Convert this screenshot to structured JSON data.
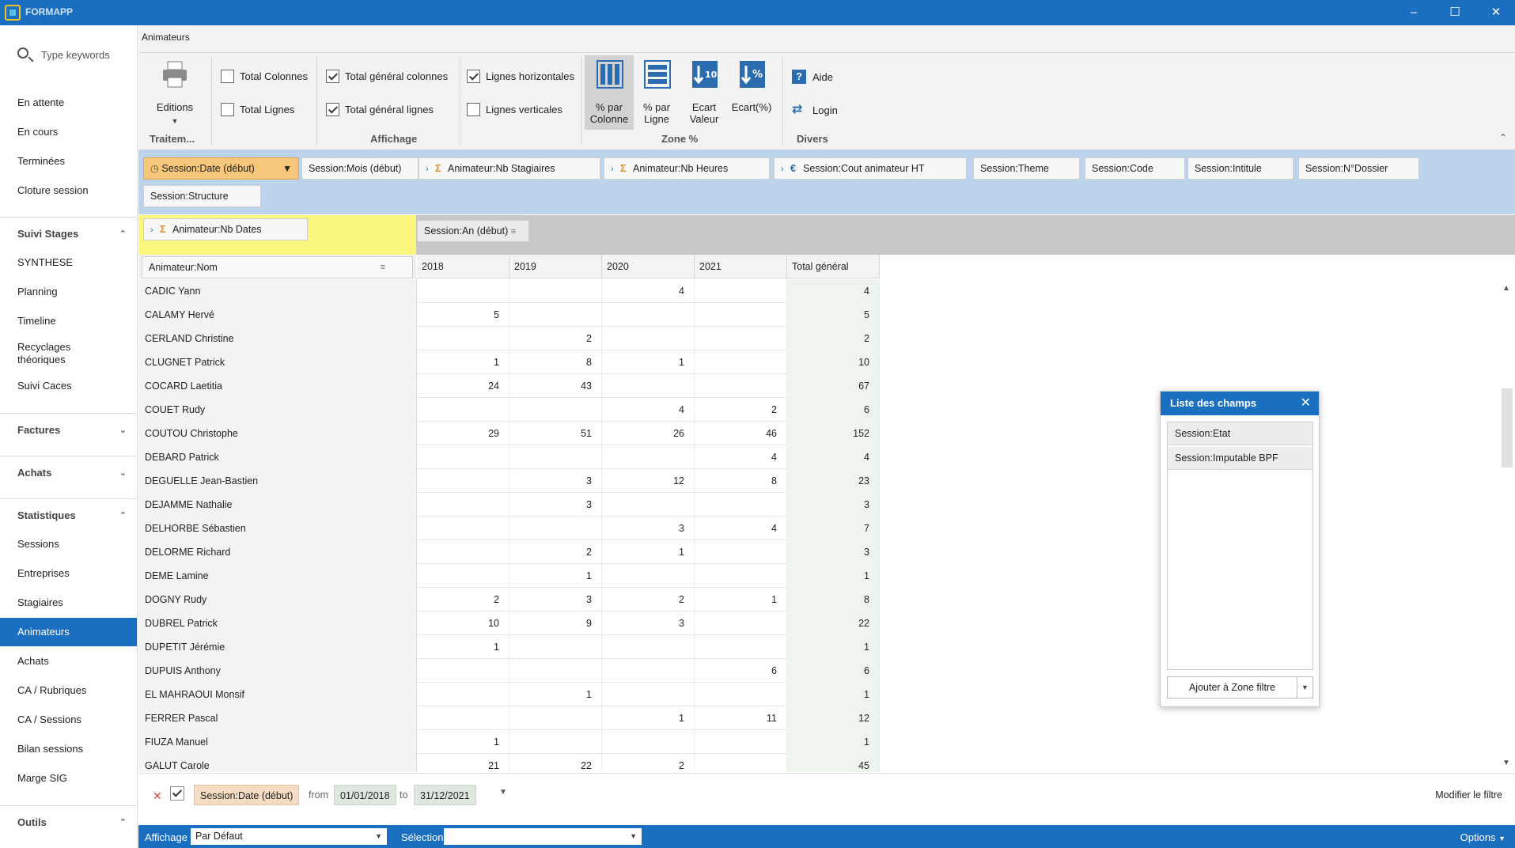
{
  "app": {
    "title": "FORMAPP"
  },
  "sidebar": {
    "search_placeholder": "Type keywords",
    "top_items": [
      "En attente",
      "En cours",
      "Terminées",
      "Cloture session"
    ],
    "suivi": {
      "label": "Suivi Stages",
      "items": [
        "SYNTHESE",
        "Planning",
        "Timeline",
        "Recyclages théoriques",
        "Suivi Caces"
      ]
    },
    "factures": {
      "label": "Factures"
    },
    "achats": {
      "label": "Achats"
    },
    "stats": {
      "label": "Statistiques",
      "items": [
        "Sessions",
        "Entreprises",
        "Stagiaires",
        "Animateurs",
        "Achats",
        "CA / Rubriques",
        "CA / Sessions",
        "Bilan sessions",
        "Marge SIG"
      ]
    },
    "outils": {
      "label": "Outils"
    }
  },
  "ribbon": {
    "tab": "Animateurs",
    "editions": "Editions",
    "traitement_label": "Traitem...",
    "affichage_label": "Affichage",
    "zone_label": "Zone %",
    "divers_label": "Divers",
    "total_colonnes": "Total Colonnes",
    "total_lignes": "Total Lignes",
    "total_general_colonnes": "Total général colonnes",
    "total_general_lignes": "Total général lignes",
    "lignes_horizontales": "Lignes horizontales",
    "lignes_verticales": "Lignes verticales",
    "pct_colonne_1": "% par",
    "pct_colonne_2": "Colonne",
    "pct_ligne_1": "% par",
    "pct_ligne_2": "Ligne",
    "ecart_valeur_1": "Ecart",
    "ecart_valeur_2": "Valeur",
    "ecart_pct": "Ecart(%)",
    "aide": "Aide",
    "login": "Login"
  },
  "filter_fields": [
    "Session:Date (début)",
    "Session:Mois (début)",
    "Animateur:Nb Stagiaires",
    "Animateur:Nb Heures",
    "Session:Cout animateur HT",
    "Session:Theme",
    "Session:Code",
    "Session:Intitule",
    "Session:N°Dossier",
    "Session:Structure"
  ],
  "data_field": "Animateur:Nb Dates",
  "column_field": "Session:An (début)",
  "row_field": "Animateur:Nom",
  "columns": [
    "2018",
    "2019",
    "2020",
    "2021",
    "Total général"
  ],
  "rows": [
    {
      "name": "CADIC Yann",
      "v": [
        "",
        "",
        "4",
        "",
        "4"
      ]
    },
    {
      "name": "CALAMY Hervé",
      "v": [
        "5",
        "",
        "",
        "",
        "5"
      ]
    },
    {
      "name": "CERLAND Christine",
      "v": [
        "",
        "2",
        "",
        "",
        "2"
      ]
    },
    {
      "name": "CLUGNET Patrick",
      "v": [
        "1",
        "8",
        "1",
        "",
        "10"
      ]
    },
    {
      "name": "COCARD Laetitia",
      "v": [
        "24",
        "43",
        "",
        "",
        "67"
      ]
    },
    {
      "name": "COUET Rudy",
      "v": [
        "",
        "",
        "4",
        "2",
        "6"
      ]
    },
    {
      "name": "COUTOU Christophe",
      "v": [
        "29",
        "51",
        "26",
        "46",
        "152"
      ]
    },
    {
      "name": "DEBARD Patrick",
      "v": [
        "",
        "",
        "",
        "4",
        "4"
      ]
    },
    {
      "name": "DEGUELLE Jean-Bastien",
      "v": [
        "",
        "3",
        "12",
        "8",
        "23"
      ]
    },
    {
      "name": "DEJAMME Nathalie",
      "v": [
        "",
        "3",
        "",
        "",
        "3"
      ]
    },
    {
      "name": "DELHORBE Sébastien",
      "v": [
        "",
        "",
        "3",
        "4",
        "7"
      ]
    },
    {
      "name": "DELORME Richard",
      "v": [
        "",
        "2",
        "1",
        "",
        "3"
      ]
    },
    {
      "name": "DEME Lamine",
      "v": [
        "",
        "1",
        "",
        "",
        "1"
      ]
    },
    {
      "name": "DOGNY Rudy",
      "v": [
        "2",
        "3",
        "2",
        "1",
        "8"
      ]
    },
    {
      "name": "DUBREL Patrick",
      "v": [
        "10",
        "9",
        "3",
        "",
        "22"
      ]
    },
    {
      "name": "DUPETIT Jérémie",
      "v": [
        "1",
        "",
        "",
        "",
        "1"
      ]
    },
    {
      "name": "DUPUIS Anthony",
      "v": [
        "",
        "",
        "",
        "6",
        "6"
      ]
    },
    {
      "name": "EL MAHRAOUI Monsif",
      "v": [
        "",
        "1",
        "",
        "",
        "1"
      ]
    },
    {
      "name": "FERRER Pascal",
      "v": [
        "",
        "",
        "1",
        "11",
        "12"
      ]
    },
    {
      "name": "FIUZA Manuel",
      "v": [
        "1",
        "",
        "",
        "",
        "1"
      ]
    },
    {
      "name": "GALUT Carole",
      "v": [
        "21",
        "22",
        "2",
        "",
        "45"
      ]
    }
  ],
  "bottom_filter": {
    "field": "Session:Date (début)",
    "from_label": "from",
    "from": "01/01/2018",
    "to_label": "to",
    "to": "31/12/2021",
    "modify": "Modifier le filtre"
  },
  "status": {
    "affichage_label": "Affichage",
    "affichage_value": "Par Défaut",
    "selection_label": "Sélection",
    "selection_value": "",
    "options": "Options"
  },
  "field_list": {
    "title": "Liste des champs",
    "items": [
      "Session:Etat",
      "Session:Imputable BPF"
    ],
    "add_button": "Ajouter à Zone filtre"
  }
}
